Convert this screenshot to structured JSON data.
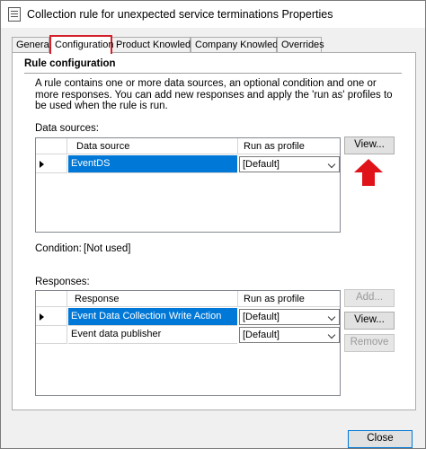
{
  "window": {
    "title": "Collection rule for unexpected service terminations Properties"
  },
  "tabs": [
    {
      "label": "General",
      "active": false
    },
    {
      "label": "Configuration",
      "active": true
    },
    {
      "label": "Product Knowledge",
      "active": false
    },
    {
      "label": "Company Knowledge",
      "active": false
    },
    {
      "label": "Overrides",
      "active": false
    }
  ],
  "rule_config": {
    "heading": "Rule configuration",
    "description": "A rule contains one or more data sources, an optional condition and one or more responses. You can add new responses and apply the 'run as' profiles to be used when the rule is run."
  },
  "data_sources": {
    "label": "Data sources:",
    "columns": [
      "Data source",
      "Run as profile"
    ],
    "rows": [
      {
        "name": "EventDS",
        "profile": "[Default]",
        "selected": true
      }
    ],
    "buttons": {
      "view": "View..."
    }
  },
  "condition": {
    "label": "Condition:",
    "value": "[Not used]"
  },
  "responses": {
    "label": "Responses:",
    "columns": [
      "Response",
      "Run as profile"
    ],
    "rows": [
      {
        "name": "Event Data Collection Write Action",
        "profile": "[Default]",
        "selected": true
      },
      {
        "name": "Event data publisher",
        "profile": "[Default]",
        "selected": false
      }
    ],
    "buttons": {
      "add": "Add...",
      "view": "View...",
      "remove": "Remove"
    }
  },
  "footer": {
    "close": "Close"
  },
  "colors": {
    "highlight": "#d3202a",
    "selection": "#0078d7"
  },
  "icons": {
    "window": "properties-window-icon",
    "annotation": "red-up-arrow-icon"
  }
}
